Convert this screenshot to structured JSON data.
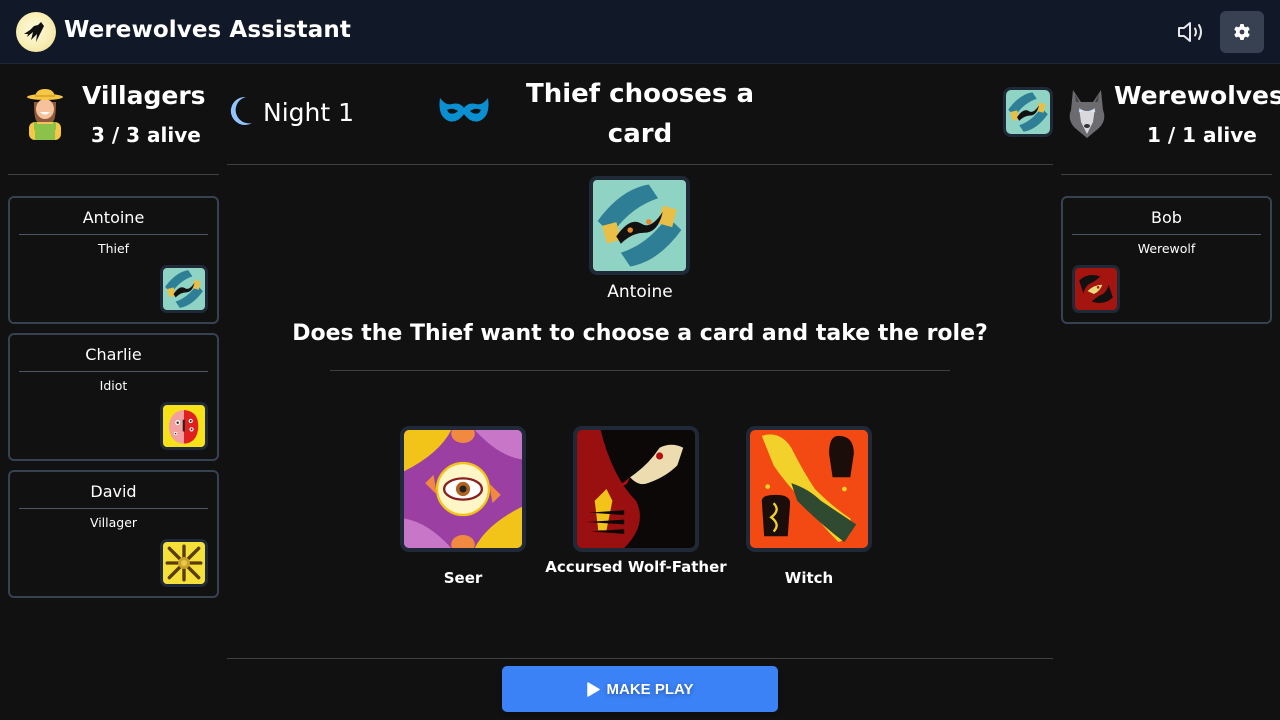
{
  "app": {
    "title": "Werewolves Assistant",
    "logo_icon": "howling-wolf-moon-icon"
  },
  "topbar": {
    "sound_icon": "speaker-icon",
    "settings_icon": "gear-icon"
  },
  "villagers": {
    "title": "Villagers",
    "alive": "3 / 3 alive",
    "avatar_icon": "farmer-avatar-icon",
    "players": [
      {
        "name": "Antoine",
        "role": "Thief",
        "role_icon": "thief-card-icon"
      },
      {
        "name": "Charlie",
        "role": "Idiot",
        "role_icon": "idiot-card-icon"
      },
      {
        "name": "David",
        "role": "Villager",
        "role_icon": "villager-card-icon"
      }
    ]
  },
  "werewolves": {
    "title": "Werewolves",
    "alive": "1 / 1 alive",
    "avatar_icon": "wolf-avatar-icon",
    "players": [
      {
        "name": "Bob",
        "role": "Werewolf",
        "role_icon": "werewolf-card-icon"
      }
    ]
  },
  "game": {
    "phase": "Night 1",
    "phase_icon": "crescent-moon-icon",
    "step_icon": "mask-icon",
    "step_title": "Thief chooses a card",
    "current_role_icon": "thief-card-icon",
    "actor": {
      "name": "Antoine",
      "role_icon": "thief-card-icon"
    },
    "question": "Does the Thief want to choose a card and take the role?",
    "choices": [
      {
        "label": "Seer",
        "icon": "seer-card-icon"
      },
      {
        "label": "Accursed Wolf-Father",
        "icon": "accursed-wolf-father-card-icon"
      },
      {
        "label": "Witch",
        "icon": "witch-card-icon"
      }
    ],
    "action_button": "MAKE PLAY",
    "action_icon": "play-icon"
  },
  "colors": {
    "topbar_bg": "#111827",
    "page_bg": "#111111",
    "card_border": "#374151",
    "accent_blue": "#3b82f6",
    "mask_blue": "#0a8fd0",
    "moon_blue": "#93c5fd"
  }
}
